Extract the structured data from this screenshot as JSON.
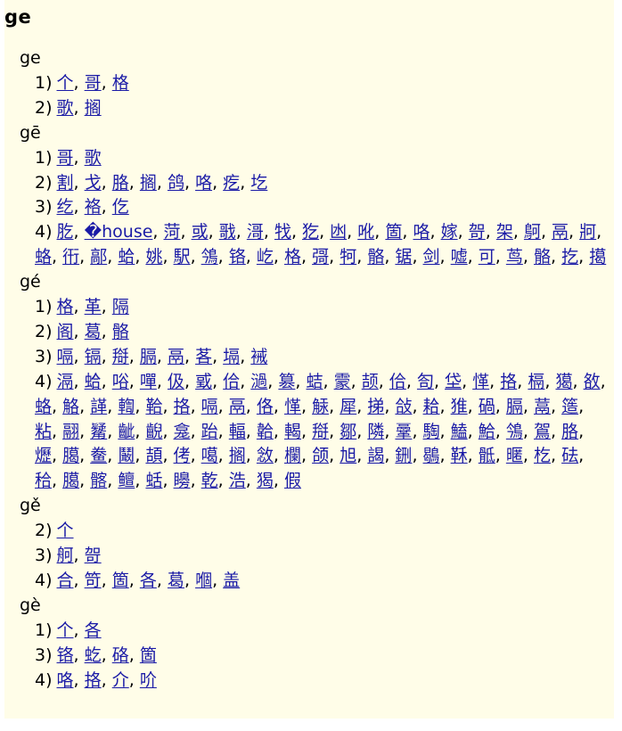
{
  "title": "ge",
  "sections": [
    {
      "pinyin": "ge",
      "groups": [
        {
          "label": "1)",
          "chars": [
            "个",
            "哥",
            "格"
          ]
        },
        {
          "label": "2)",
          "chars": [
            "歌",
            "搁"
          ]
        }
      ]
    },
    {
      "pinyin": "gē",
      "groups": [
        {
          "label": "1)",
          "chars": [
            "哥",
            "歌"
          ]
        },
        {
          "label": "2)",
          "chars": [
            "割",
            "戈",
            "胳",
            "搁",
            "鸽",
            "咯",
            "疙",
            "圪"
          ]
        },
        {
          "label": "3)",
          "chars": [
            "纥",
            "袼",
            "仡"
          ]
        },
        {
          "label": "4)",
          "chars": [
            "肐",
            "�house",
            "菏",
            "或",
            "戨",
            "滒",
            "牫",
            "犵",
            "凼",
            "吪",
            "箇",
            "咯",
            "嫁",
            "哿",
            "架",
            "鴚",
            "鬲",
            "牁",
            "蛒",
            "衎",
            "鄗",
            "蛤",
            "姚",
            "駅",
            "鳹",
            "铬",
            "屹",
            "格",
            "彁",
            "牱",
            "骼",
            "锯",
            "剑",
            "嘘",
            "可",
            "茑",
            "骼",
            "扢",
            "擖"
          ]
        }
      ]
    },
    {
      "pinyin": "gé",
      "groups": [
        {
          "label": "1)",
          "chars": [
            "格",
            "革",
            "隔"
          ]
        },
        {
          "label": "2)",
          "chars": [
            "阁",
            "葛",
            "骼"
          ]
        },
        {
          "label": "3)",
          "chars": [
            "嗝",
            "镉",
            "搿",
            "膈",
            "鬲",
            "茖",
            "塥",
            "裓"
          ]
        },
        {
          "label": "4)",
          "chars": [
            "滆",
            "蛤",
            "唂",
            "嘽",
            "伋",
            "戜",
            "佮",
            "濄",
            "篡",
            "蛣",
            "霥",
            "颉",
            "佮",
            "匌",
            "垈",
            "愅",
            "挌",
            "槅",
            "獦",
            "敋",
            "蛒",
            "觡",
            "諽",
            "輷",
            "鞈",
            "挌",
            "嗝",
            "鬲",
            "佫",
            "愅",
            "觨",
            "犀",
            "挮",
            "敆",
            "耠",
            "猚",
            "碢",
            "膈",
            "蒚",
            "簉",
            "粘",
            "翮",
            "觺",
            "齜",
            "齯",
            "龛",
            "跆",
            "輻",
            "韐",
            "輵",
            "搿",
            "鄒",
            "隣",
            "鞷",
            "騊",
            "鰪",
            "鮯",
            "鳹",
            "鴐",
            "胳",
            "爏",
            "臈",
            "鲞",
            "鬫",
            "頡",
            "侤",
            "噶",
            "搁",
            "敜",
            "欄",
            "颌",
            "旭",
            "謁",
            "鉶",
            "鶡",
            "鞂",
            "骶",
            "暱",
            "杚",
            "砝",
            "秴",
            "臈",
            "髂",
            "鳣",
            "蛞",
            "矏",
            "乾",
            "浩",
            "猲",
            "假"
          ]
        }
      ]
    },
    {
      "pinyin": "gě",
      "groups": [
        {
          "label": "2)",
          "chars": [
            "个"
          ]
        },
        {
          "label": "3)",
          "chars": [
            "舸",
            "哿"
          ]
        },
        {
          "label": "4)",
          "chars": [
            "合",
            "笴",
            "箇",
            "各",
            "葛",
            "嗰",
            "盖"
          ]
        }
      ]
    },
    {
      "pinyin": "gè",
      "groups": [
        {
          "label": "1)",
          "chars": [
            "个",
            "各"
          ]
        },
        {
          "label": "3)",
          "chars": [
            "铬",
            "虼",
            "硌",
            "箇"
          ]
        },
        {
          "label": "4)",
          "chars": [
            "咯",
            "挌",
            "介",
            "吤"
          ]
        }
      ]
    }
  ]
}
